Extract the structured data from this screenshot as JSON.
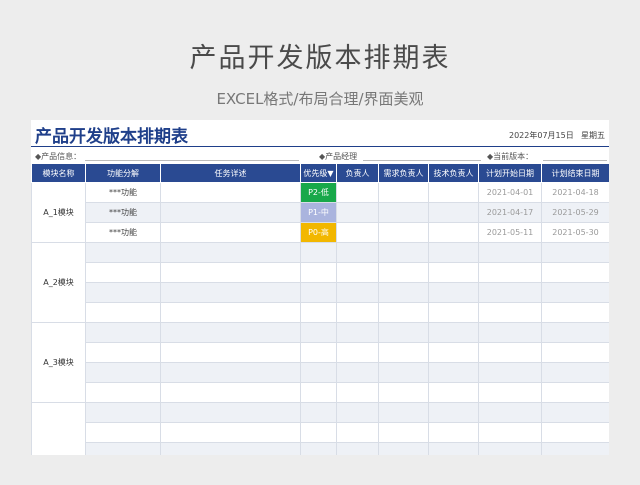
{
  "hero": {
    "title": "产品开发版本排期表",
    "subtitle": "EXCEL格式/布局合理/界面美观"
  },
  "sheet": {
    "title": "产品开发版本排期表",
    "date": "2022年07月15日",
    "weekday": "星期五",
    "info": {
      "product_info": "◆产品信息：",
      "product_manager": "◆产品经理",
      "current_version": "◆当前版本："
    },
    "columns": [
      "模块名称",
      "功能分解",
      "任务详述",
      "优先级▼",
      "负责人",
      "需求负责人",
      "技术负责人",
      "计划开始日期",
      "计划结束日期"
    ],
    "modules": [
      "A_1模块",
      "A_2模块",
      "A_3模块"
    ],
    "rows": [
      {
        "feature": "***功能",
        "priority": "P2-低",
        "start": "2021-04-01",
        "end": "2021-04-18"
      },
      {
        "feature": "***功能",
        "priority": "P1-中",
        "start": "2021-04-17",
        "end": "2021-05-29"
      },
      {
        "feature": "***功能",
        "priority": "P0-高",
        "start": "2021-05-11",
        "end": "2021-05-30"
      }
    ],
    "colors": {
      "header": "#2a4a92",
      "title": "#1f3f8a",
      "p2": "#18a84a",
      "p1": "#aab4de",
      "p0": "#f2b700",
      "alt_row": "#eef1f6"
    }
  }
}
